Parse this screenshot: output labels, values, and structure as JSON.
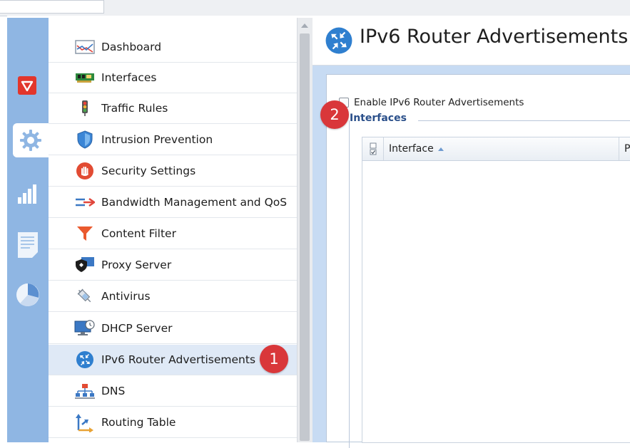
{
  "nav": {
    "items": [
      {
        "label": "Dashboard",
        "icon": "dashboard-icon"
      },
      {
        "label": "Interfaces",
        "icon": "network-card-icon"
      },
      {
        "label": "Traffic Rules",
        "icon": "traffic-light-icon"
      },
      {
        "label": "Intrusion Prevention",
        "icon": "shield-icon"
      },
      {
        "label": "Security Settings",
        "icon": "stop-hand-icon"
      },
      {
        "label": "Bandwidth Management and QoS",
        "icon": "bandwidth-arrows-icon"
      },
      {
        "label": "Content Filter",
        "icon": "funnel-icon"
      },
      {
        "label": "Proxy Server",
        "icon": "proxy-shield-icon"
      },
      {
        "label": "Antivirus",
        "icon": "syringe-icon"
      },
      {
        "label": "DHCP Server",
        "icon": "dhcp-monitor-icon"
      },
      {
        "label": "IPv6 Router Advertisements",
        "icon": "router-icon"
      },
      {
        "label": "DNS",
        "icon": "dns-tree-icon"
      },
      {
        "label": "Routing Table",
        "icon": "routing-arrows-icon"
      }
    ],
    "selected": "IPv6 Router Advertisements"
  },
  "rail": {
    "items": [
      "logo-icon",
      "gear-icon",
      "bar-chart-icon",
      "document-icon",
      "pie-chart-icon"
    ],
    "active": "gear-icon"
  },
  "page": {
    "title": "IPv6 Router Advertisements",
    "enable_label": "Enable IPv6 Router Advertisements",
    "enable_checked": false,
    "section_legend": "Interfaces"
  },
  "grid": {
    "columns": [
      "Interface",
      "Pref"
    ],
    "sort_column": "Interface",
    "sort_direction": "ascending",
    "rows": []
  },
  "annotations": {
    "badge_1": "1",
    "badge_2": "2"
  },
  "colors": {
    "rail": "#8fb6e3",
    "selected_row": "#dfe9f6",
    "badge": "#d9373a",
    "legend_text": "#2a4f8a",
    "content_band": "#c7dbf3"
  }
}
